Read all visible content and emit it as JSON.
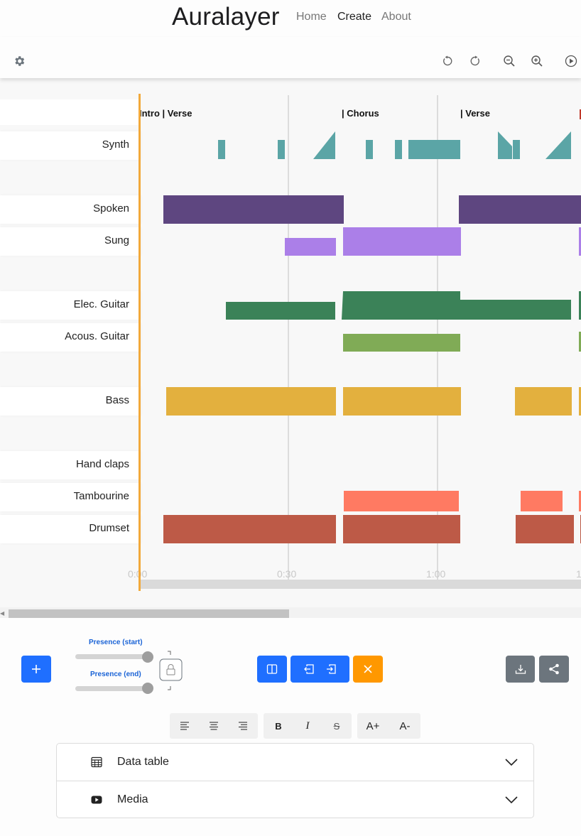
{
  "app": {
    "brand": "Auralayer",
    "nav": [
      {
        "label": "Home",
        "active": false
      },
      {
        "label": "Create",
        "active": true
      },
      {
        "label": "About",
        "active": false
      }
    ]
  },
  "toolbar": {
    "icons": [
      "gear-icon",
      "undo-icon",
      "redo-icon",
      "zoom-out-icon",
      "zoom-in-icon",
      "play-icon"
    ]
  },
  "sections": [
    {
      "label": "Intro | Verse"
    },
    {
      "label": "| Chorus"
    },
    {
      "label": "| Verse"
    }
  ],
  "layers": [
    {
      "name": "Synth",
      "color": "#5ba5a6"
    },
    {
      "name": "Spoken",
      "color": "#5e4680"
    },
    {
      "name": "Sung",
      "color": "#ab7fe8"
    },
    {
      "name": "Elec. Guitar",
      "color": "#3b8258"
    },
    {
      "name": "Acous. Guitar",
      "color": "#80ab56"
    },
    {
      "name": "Bass",
      "color": "#e3b03e"
    },
    {
      "name": "Hand claps",
      "color": "#f0a030"
    },
    {
      "name": "Tambourine",
      "color": "#ff7a62"
    },
    {
      "name": "Drumset",
      "color": "#bd5a47"
    }
  ],
  "timeline": {
    "ticks": [
      "0:00",
      "0:30",
      "1:00",
      "1"
    ],
    "playhead_color": "#f2a93b"
  },
  "controls": {
    "add_icon": "plus-icon",
    "presence_start_label": "Presence (start)",
    "presence_end_label": "Presence (end)",
    "lock_icon": "lock-icon",
    "edit_icons": [
      "split-icon",
      "merge-left-icon",
      "merge-right-icon",
      "delete-icon"
    ],
    "export_icons": [
      "download-icon",
      "share-icon"
    ],
    "text_format": {
      "align": [
        "align-left-icon",
        "align-center-icon",
        "align-right-icon"
      ],
      "style": [
        "B",
        "I",
        "S"
      ],
      "size": [
        "A+",
        "A-"
      ]
    }
  },
  "accordion": [
    {
      "title": "Data table",
      "icon": "table-icon"
    },
    {
      "title": "Media",
      "icon": "youtube-icon"
    }
  ]
}
